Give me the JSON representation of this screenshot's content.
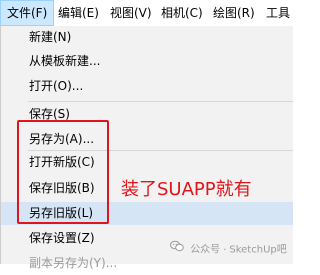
{
  "menubar": {
    "items": [
      {
        "label": "文件(F)",
        "active": true
      },
      {
        "label": "编辑(E)"
      },
      {
        "label": "视图(V)"
      },
      {
        "label": "相机(C)"
      },
      {
        "label": "绘图(R)"
      },
      {
        "label": "工具"
      }
    ]
  },
  "menu": {
    "items": [
      {
        "label": "新建(N)"
      },
      {
        "label": "从模板新建..."
      },
      {
        "label": "打开(O)..."
      },
      {
        "label": "保存(S)"
      },
      {
        "label": "另存为(A)..."
      },
      {
        "label": "打开新版(C)"
      },
      {
        "label": "保存旧版(B)"
      },
      {
        "label": "另存旧版(L)",
        "highlighted": true
      },
      {
        "label": "保存设置(Z)"
      },
      {
        "label": "副本另存为(Y)..."
      }
    ]
  },
  "annotation": {
    "text": "装了SUAPP就有",
    "color": "#e0151b"
  },
  "watermark": {
    "prefix": "公众号",
    "dot": "·",
    "name": "SketchUp吧"
  },
  "colors": {
    "menu_bg": "#f2f2f2",
    "highlight_bg": "#d5e5f5",
    "active_menu_bg": "#cce8ff",
    "annotation_red": "#e0151b"
  }
}
